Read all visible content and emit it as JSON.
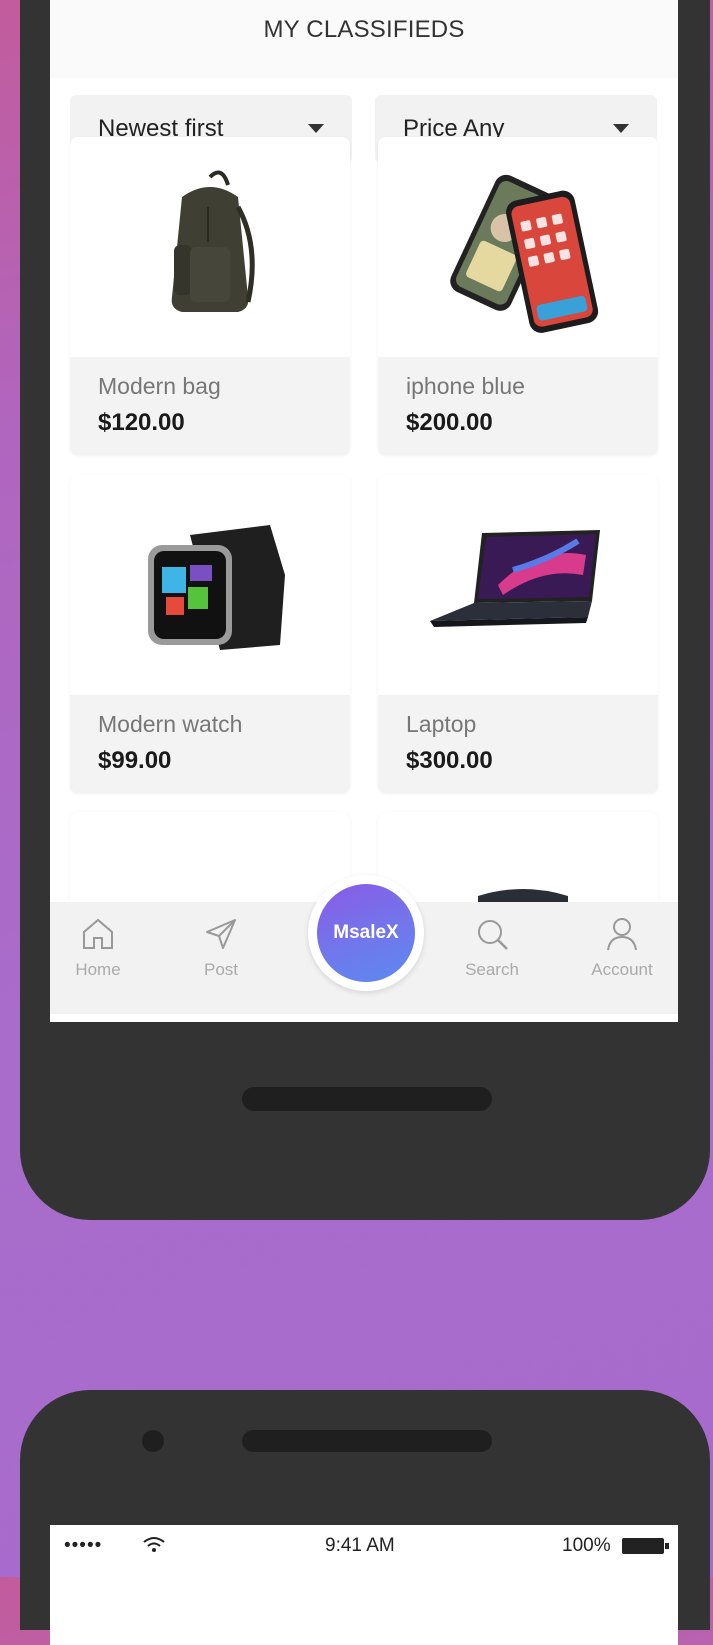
{
  "header": {
    "title": "MY CLASSIFIEDS"
  },
  "filters": {
    "sort": {
      "value": "Newest first",
      "icon": "caret-down-icon"
    },
    "price": {
      "value": "Price Any",
      "icon": "caret-down-icon"
    }
  },
  "listings": [
    {
      "name": "Modern bag",
      "price": "$120.00",
      "image": "backpack-image"
    },
    {
      "name": "iphone blue",
      "price": "$200.00",
      "image": "smartphones-image"
    },
    {
      "name": "Modern watch",
      "price": "$99.00",
      "image": "smartwatch-image"
    },
    {
      "name": "Laptop",
      "price": "$300.00",
      "image": "laptop-image"
    }
  ],
  "tabbar": {
    "items": [
      {
        "label": "Home",
        "icon": "home-icon"
      },
      {
        "label": "Post",
        "icon": "send-icon"
      },
      {
        "label": "Search",
        "icon": "search-icon"
      },
      {
        "label": "Account",
        "icon": "user-icon"
      }
    ],
    "center": {
      "label": "MsaleX"
    }
  },
  "status_bar": {
    "time": "9:41 AM",
    "battery": "100%",
    "signal": "•••••"
  },
  "colors": {
    "background_top": "#c25c9c",
    "background_bottom": "#a66bcc",
    "phone_body": "#333333",
    "accent_start": "#8a5be6",
    "accent_end": "#5b8af0"
  }
}
